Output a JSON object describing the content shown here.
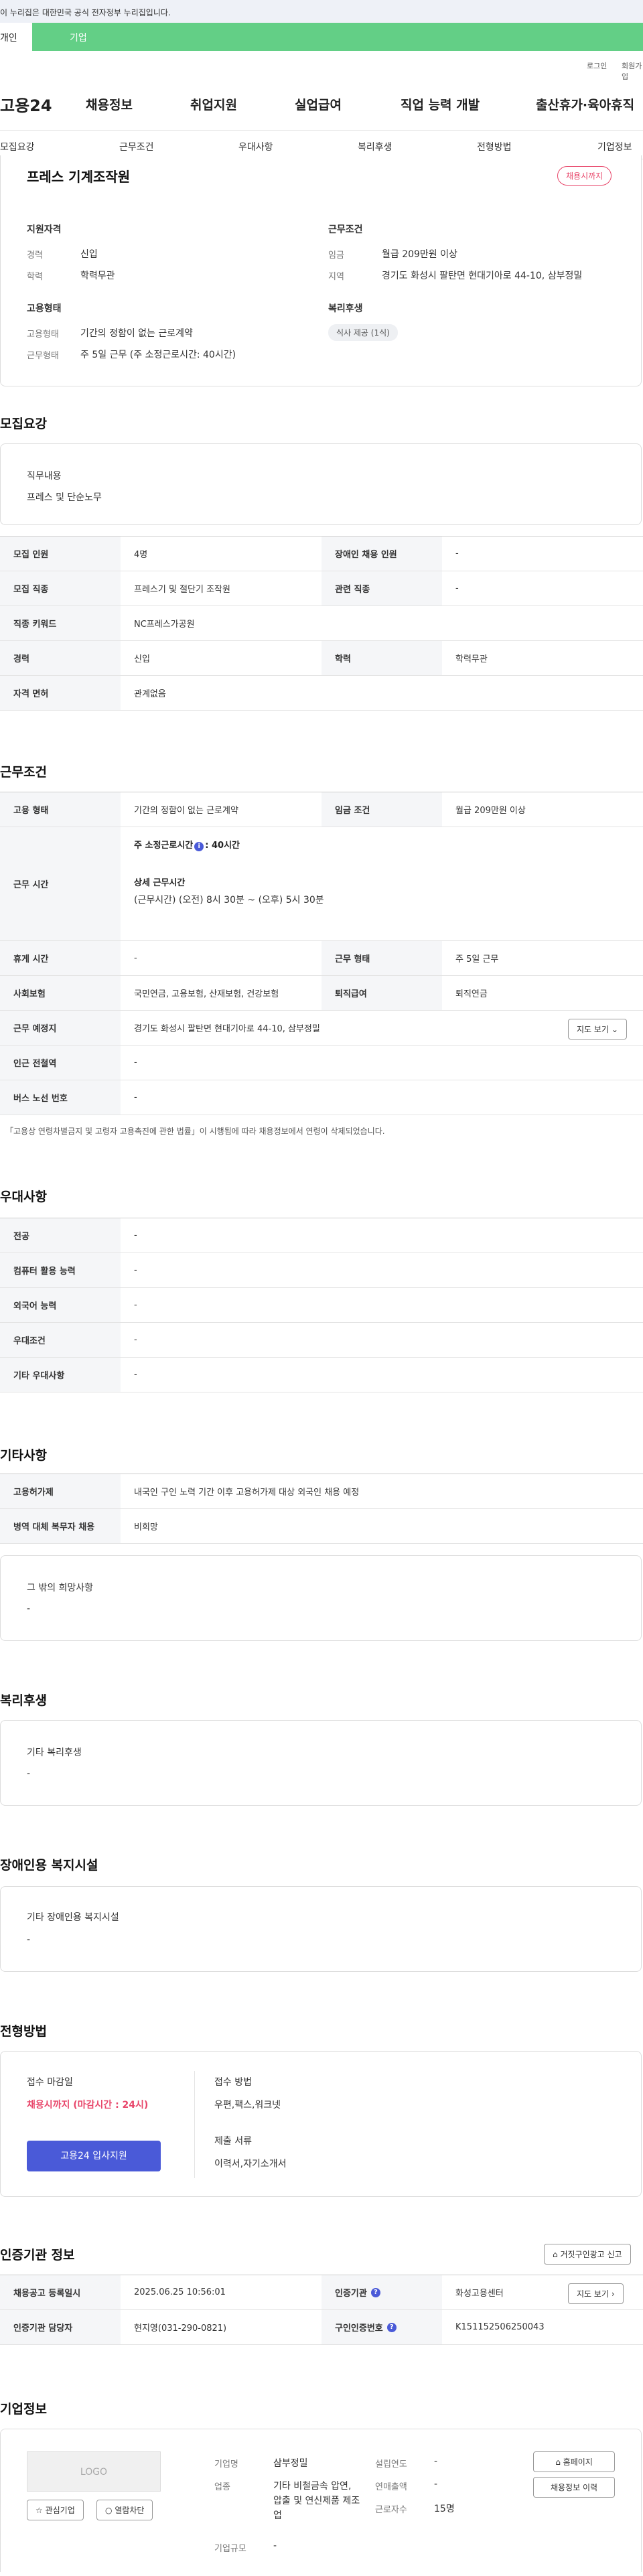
{
  "gov_banner": "이 누리집은 대한민국 공식 전자정부 누리집입니다.",
  "tabs": {
    "individual": "개인",
    "company": "기업"
  },
  "util": {
    "login": "로그인",
    "join": "회원가입"
  },
  "logo": "고용24",
  "gnb": [
    "채용정보",
    "취업지원",
    "실업급여",
    "직업 능력 개발",
    "출산휴가·육아휴직"
  ],
  "subnav": [
    "모집요강",
    "근무조건",
    "우대사항",
    "복리후생",
    "전형방법",
    "기업정보"
  ],
  "job": {
    "title": "프레스 기계조작원",
    "status_badge": "채용시까지",
    "qual_title": "지원자격",
    "qual": [
      {
        "k": "경력",
        "v": "신입"
      },
      {
        "k": "학력",
        "v": "학력무관"
      }
    ],
    "emp_title": "고용형태",
    "emp": [
      {
        "k": "고용형태",
        "v": "기간의 정함이 없는 근로계약"
      },
      {
        "k": "근무형태",
        "v": "주 5일 근무 (주 소정근로시간: 40시간)"
      }
    ],
    "cond_title": "근무조건",
    "cond": [
      {
        "k": "임금",
        "v": "월급 209만원 이상"
      },
      {
        "k": "지역",
        "v": "경기도 화성시 팔탄면 현대기아로 44-10, 삼부정밀"
      }
    ],
    "welfare_title": "복리후생",
    "welfare_pill": "식사 제공 (1식)"
  },
  "recruit": {
    "title": "모집요강",
    "duty_label": "직무내용",
    "duty_value": "프레스 및 단순노무",
    "rows": [
      {
        "k1": "모집 인원",
        "v1": "4명",
        "k2": "장애인 채용 인원",
        "v2": "-"
      },
      {
        "k1": "모집 직종",
        "v1": "프레스기 및 절단기 조작원",
        "k2": "관련 직종",
        "v2": "-"
      },
      {
        "k1": "직종 키워드",
        "v1": "NC프레스가공원"
      },
      {
        "k1": "경력",
        "v1": "신입",
        "k2": "학력",
        "v2": "학력무관"
      },
      {
        "k1": "자격 면허",
        "v1": "관계없음"
      }
    ]
  },
  "work": {
    "title": "근무조건",
    "type_k": "고용 형태",
    "type_v": "기간의 정함이 없는 근로계약",
    "wage_k": "임금 조건",
    "wage_v": "월급 209만원 이상",
    "hours_k": "근무 시간",
    "hours_line1": "주 소정근로시간",
    "hours_line1b": ": 40시간",
    "hours_detail_label": "상세 근무시간",
    "hours_detail": "(근무시간) (오전) 8시 30분 ~ (오후) 5시 30분",
    "rest_k": "휴게 시간",
    "rest_v": "-",
    "form_k": "근무 형태",
    "form_v": "주 5일 근무",
    "ins_k": "사회보험",
    "ins_v": "국민연금, 고용보험, 산재보험, 건강보험",
    "ret_k": "퇴직급여",
    "ret_v": "퇴직연금",
    "place_k": "근무 예정지",
    "place_v": "경기도 화성시 팔탄면 현대기아로 44-10, 삼부정밀",
    "map_btn": "지도 보기",
    "subway_k": "인근 전철역",
    "subway_v": "-",
    "bus_k": "버스 노선 번호",
    "bus_v": "-",
    "note": "「고용상 연령차별금지 및 고령자 고용촉진에 관한 법률」이 시행됨에 따라 채용정보에서 연령이 삭제되었습니다."
  },
  "pref": {
    "title": "우대사항",
    "rows": [
      {
        "k": "전공",
        "v": "-"
      },
      {
        "k": "컴퓨터 활용 능력",
        "v": "-"
      },
      {
        "k": "외국어 능력",
        "v": "-"
      },
      {
        "k": "우대조건",
        "v": "-"
      },
      {
        "k": "기타 우대사항",
        "v": "-"
      }
    ]
  },
  "etc": {
    "title": "기타사항",
    "rows": [
      {
        "k": "고용허가제",
        "v": "내국인 구인 노력 기간 이후 고용허가제 대상 외국인 채용 예정"
      },
      {
        "k": "병역 대체 복무자 채용",
        "v": "비희망"
      }
    ],
    "other_label": "그 밖의 희망사항",
    "other_value": "-"
  },
  "welfare": {
    "title": "복리후생",
    "label": "기타 복리후생",
    "value": "-"
  },
  "disabled": {
    "title": "장애인용 복지시설",
    "label": "기타 장애인용 복지시설",
    "value": "-"
  },
  "screening": {
    "title": "전형방법",
    "deadline_label": "접수 마감일",
    "deadline_value": "채용시까지 (마감시간 : 24시)",
    "apply_btn": "고용24 입사지원",
    "method_label": "접수 방법",
    "method_value": "우편,팩스,워크넷",
    "docs_label": "제출 서류",
    "docs_value": "이력서,자기소개서"
  },
  "agency": {
    "title": "인증기관 정보",
    "report_btn": "거짓구인광고 신고",
    "reg_k": "채용공고 등록일시",
    "reg_v": "2025.06.25 10:56:01",
    "org_k": "인증기관",
    "org_v": "화성고용센터",
    "map_btn": "지도 보기",
    "mgr_k": "인증기관 담당자",
    "mgr_v": "현지영(031-290-0821)",
    "id_k": "구인인증번호",
    "id_v": "K151152506250043"
  },
  "company": {
    "title": "기업정보",
    "logo_text": "LOGO",
    "interest_btn": "관심기업",
    "block_btn": "열람차단",
    "name_k": "기업명",
    "name_v": "삼부정밀",
    "ind_k": "업종",
    "ind_v": "기타 비철금속 압연, 압출 및 연신제품 제조업",
    "size_k": "기업규모",
    "size_v": "-",
    "est_k": "설립연도",
    "est_v": "-",
    "sales_k": "연매출액",
    "sales_v": "-",
    "emp_k": "근로자수",
    "emp_v": "15명",
    "home_btn": "홈페이지",
    "history_btn": "채용정보 이력"
  },
  "colors": {
    "brand_green": "#63cf86",
    "primary": "#4a5ad8",
    "red": "#e8466a"
  }
}
